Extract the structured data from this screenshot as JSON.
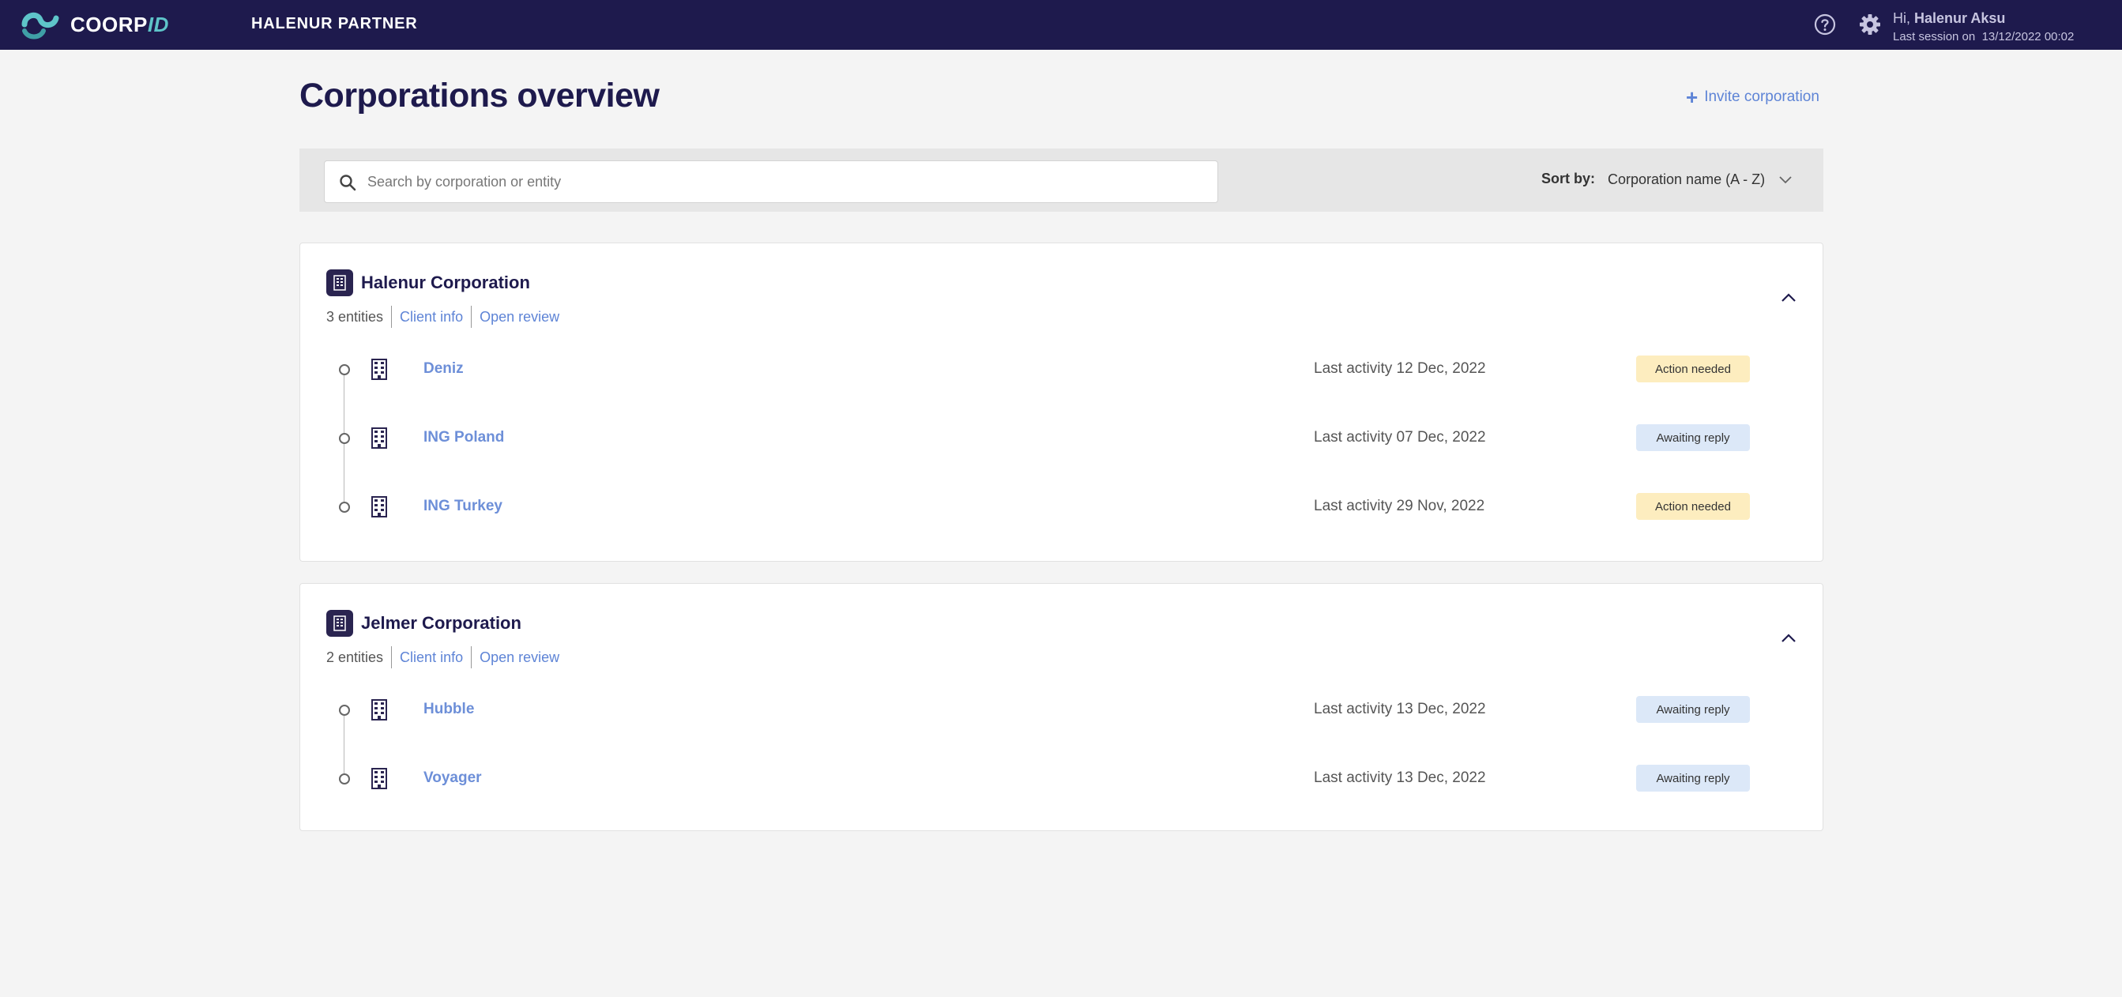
{
  "header": {
    "logo_main": "COORP",
    "logo_accent": "ID",
    "partner": "HALENUR PARTNER",
    "greeting_prefix": "Hi, ",
    "user_name": "Halenur Aksu",
    "session_label": "Last session on",
    "session_time": "13/12/2022 00:02"
  },
  "page": {
    "title": "Corporations overview",
    "invite_label": "Invite corporation"
  },
  "filters": {
    "search_placeholder": "Search by corporation or entity",
    "search_value": "",
    "sort_label": "Sort by:",
    "sort_value": "Corporation name (A - Z)"
  },
  "corporations": [
    {
      "name": "Halenur Corporation",
      "entity_count": "3 entities",
      "client_info": "Client info",
      "open_review": "Open review",
      "entities": [
        {
          "name": "Deniz",
          "activity": "Last activity 12 Dec, 2022",
          "status": "Action needed",
          "status_type": "action"
        },
        {
          "name": "ING Poland",
          "activity": "Last activity 07 Dec, 2022",
          "status": "Awaiting reply",
          "status_type": "awaiting"
        },
        {
          "name": "ING Turkey",
          "activity": "Last activity 29 Nov, 2022",
          "status": "Action needed",
          "status_type": "action"
        }
      ]
    },
    {
      "name": "Jelmer Corporation",
      "entity_count": "2 entities",
      "client_info": "Client info",
      "open_review": "Open review",
      "entities": [
        {
          "name": "Hubble",
          "activity": "Last activity 13 Dec, 2022",
          "status": "Awaiting reply",
          "status_type": "awaiting"
        },
        {
          "name": "Voyager",
          "activity": "Last activity 13 Dec, 2022",
          "status": "Awaiting reply",
          "status_type": "awaiting"
        }
      ]
    }
  ],
  "colors": {
    "header_bg": "#1e1a4d",
    "accent_teal": "#5ec4c9",
    "link_blue": "#5e84d6",
    "action_needed_bg": "#fdedbf",
    "awaiting_reply_bg": "#dce8f8"
  }
}
